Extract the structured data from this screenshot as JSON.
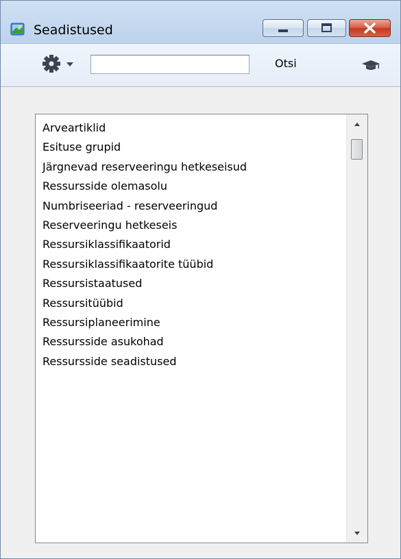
{
  "window": {
    "title": "Seadistused"
  },
  "toolbar": {
    "search_value": "",
    "search_label": "Otsi",
    "icons": [
      "gear-icon",
      "chevron-down-icon",
      "graduation-cap-icon"
    ]
  },
  "list": {
    "items": [
      "Arveartiklid",
      "Esituse grupid",
      "Järgnevad reserveeringu hetkeseisud",
      "Ressursside olemasolu",
      "Numbriseeriad - reserveeringud",
      "Reserveeringu hetkeseis",
      "Ressursiklassifikaatorid",
      "Ressursiklassifikaatorite tüübid",
      "Ressursistaatused",
      "Ressursitüübid",
      "Ressursiplaneerimine",
      "Ressursside asukohad",
      "Ressursside seadistused"
    ]
  },
  "colors": {
    "titlebar": "#bcd3ec",
    "close_button": "#c4391f",
    "content_bg": "#f0f0f0"
  }
}
